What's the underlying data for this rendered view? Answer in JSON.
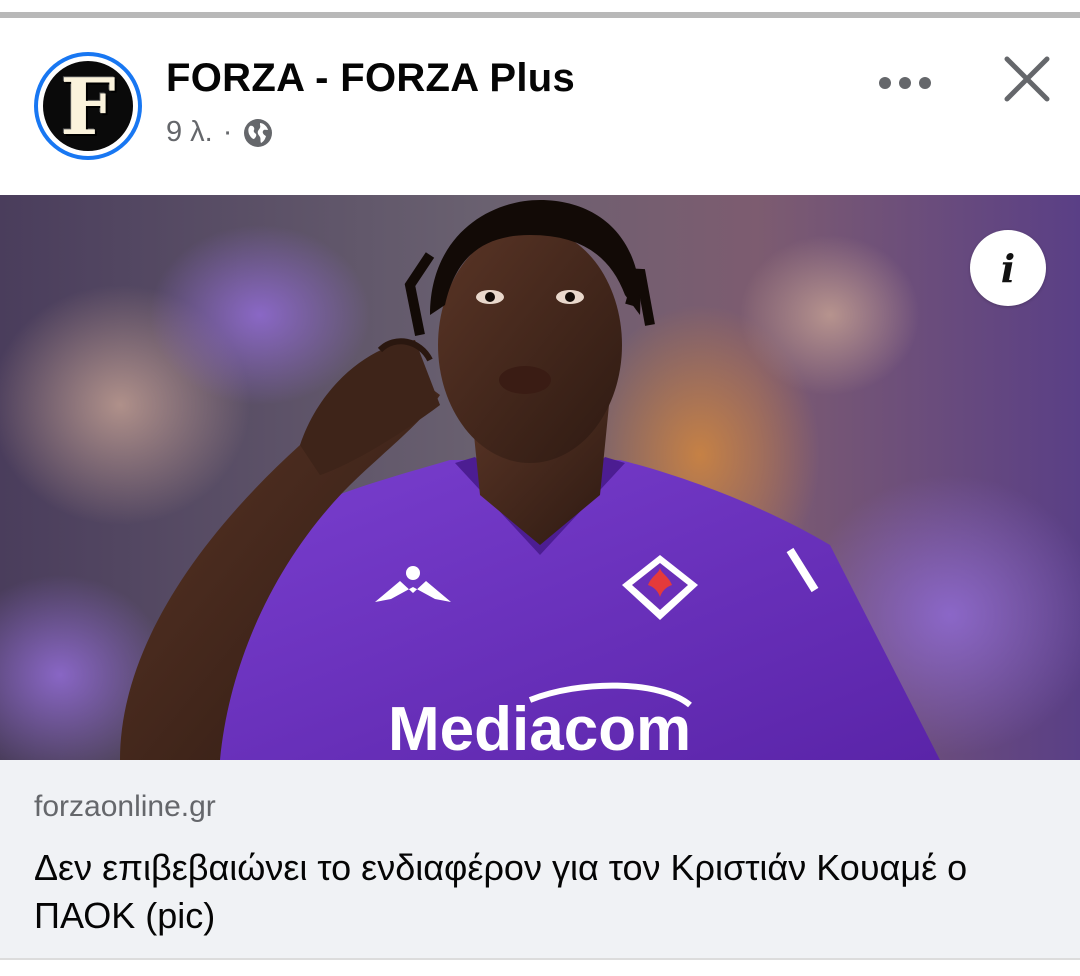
{
  "post": {
    "page_name": "FORZA - FORZA Plus",
    "avatar_letter": "F",
    "time_ago": "9 λ.",
    "separator": "·",
    "audience_icon": "globe-icon"
  },
  "actions": {
    "more_icon": "more-horizontal-icon",
    "close_icon": "close-icon",
    "info_glyph": "i"
  },
  "image": {
    "jersey_sponsor": "Mediacom"
  },
  "link": {
    "domain": "forzaonline.gr",
    "title": "Δεν επιβεβαιώνει το ενδιαφέρον για τον Κριστιάν Κουαμέ ο ΠΑΟΚ (pic)"
  },
  "colors": {
    "accent": "#1877f2",
    "secondary_text": "#65676b",
    "preview_bg": "#f0f2f5",
    "jersey_purple": "#6a2fb8"
  }
}
